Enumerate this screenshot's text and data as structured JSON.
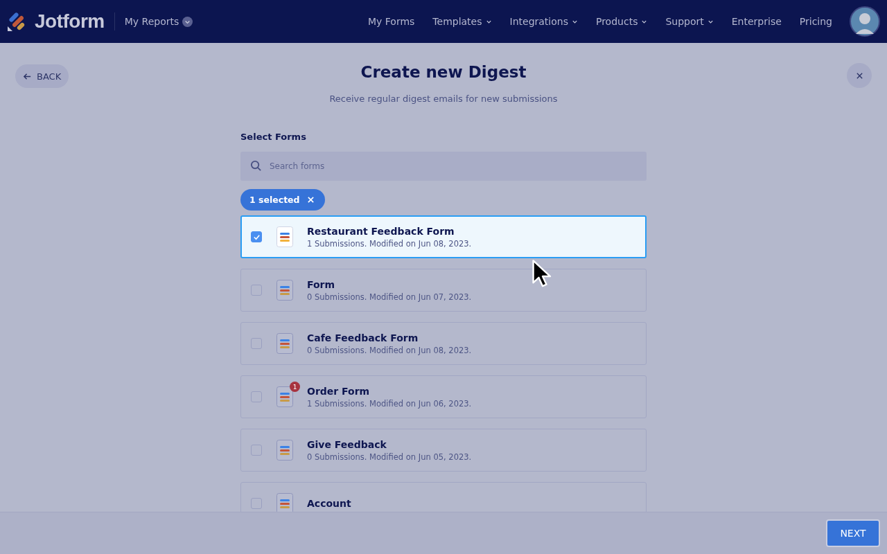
{
  "header": {
    "logo": "Jotform",
    "reports_menu": "My Reports",
    "nav": [
      {
        "label": "My Forms",
        "dropdown": false
      },
      {
        "label": "Templates",
        "dropdown": true
      },
      {
        "label": "Integrations",
        "dropdown": true
      },
      {
        "label": "Products",
        "dropdown": true
      },
      {
        "label": "Support",
        "dropdown": true
      },
      {
        "label": "Enterprise",
        "dropdown": false
      },
      {
        "label": "Pricing",
        "dropdown": false
      }
    ]
  },
  "back_button": "BACK",
  "title": "Create new Digest",
  "subtitle": "Receive regular digest emails for new submissions",
  "section_label": "Select Forms",
  "search": {
    "placeholder": "Search forms"
  },
  "selection_chip": "1 selected",
  "forms": [
    {
      "name": "Restaurant Feedback Form",
      "details": "1 Submissions. Modified on Jun 08, 2023.",
      "selected": true
    },
    {
      "name": "Form",
      "details": "0 Submissions. Modified on Jun 07, 2023.",
      "selected": false
    },
    {
      "name": "Cafe Feedback Form",
      "details": "0 Submissions. Modified on Jun 08, 2023.",
      "selected": false
    },
    {
      "name": "Order Form",
      "details": "1 Submissions. Modified on Jun 06, 2023.",
      "selected": false,
      "badge": "1"
    },
    {
      "name": "Give Feedback",
      "details": "0 Submissions. Modified on Jun 05, 2023.",
      "selected": false
    },
    {
      "name": "Account",
      "selected": false
    }
  ],
  "next_button": "NEXT"
}
